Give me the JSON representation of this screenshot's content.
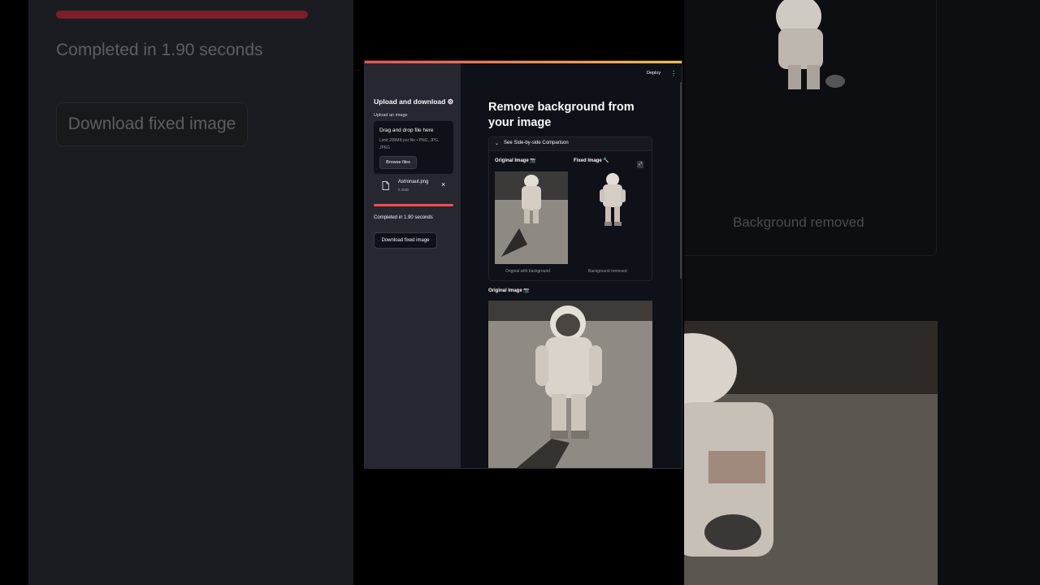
{
  "background": {
    "left": {
      "completed_text": "Completed in 1.90 seconds",
      "download_label": "Download fixed image"
    },
    "right": {
      "caption": "Background removed"
    }
  },
  "header": {
    "deploy_label": "Deploy",
    "menu_icon": "kebab-icon"
  },
  "sidebar": {
    "title": "Upload and download ⚙",
    "uploader_label": "Upload an image",
    "dropzone": {
      "title": "Drag and drop file here",
      "limit": "Limit 200MB per file • PNG, JPG, JPEG",
      "browse_label": "Browse files"
    },
    "file": {
      "name": "Astronaut.png",
      "size": "6.3MB"
    },
    "progress": 1.0,
    "status_text": "Completed in 1.90 seconds",
    "download_label": "Download fixed image"
  },
  "main": {
    "title": "Remove background from your image",
    "expander_label": "See Side-by-side Comparison",
    "original_title": "Original Image 📷",
    "fixed_title": "Fixed Image 🔧",
    "original_caption": "Original with background",
    "fixed_caption": "Background removed",
    "original_section_title": "Original Image 📷"
  },
  "colors": {
    "accent": "#ff4b4b",
    "sidebar_bg": "#262730",
    "main_bg": "#0e1117"
  }
}
